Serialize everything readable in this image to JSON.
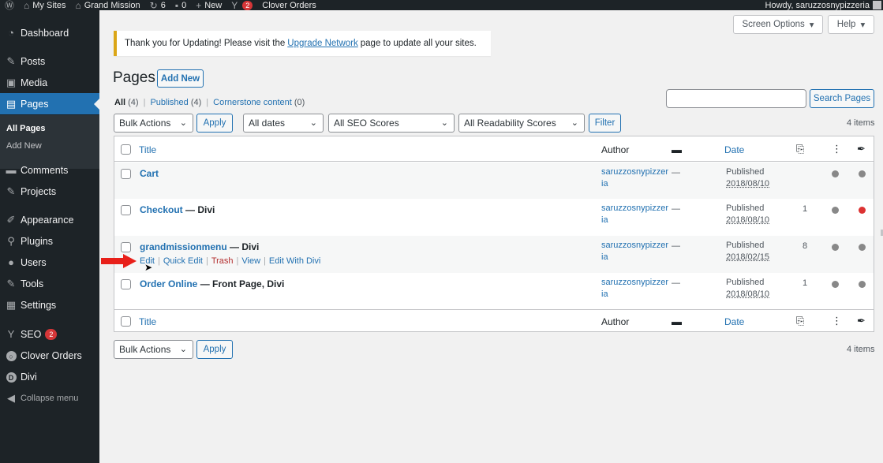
{
  "adminbar": {
    "my_sites": "My Sites",
    "site_name": "Grand Mission",
    "updates_count": "6",
    "comments_count": "0",
    "new_label": "New",
    "seo_badge": "2",
    "clover_orders": "Clover Orders",
    "howdy": "Howdy, saruzzosnypizzeria"
  },
  "sidebar": {
    "items": [
      {
        "label": "Dashboard",
        "icon": "dashboard-icon"
      },
      {
        "label": "Posts",
        "icon": "pin-icon"
      },
      {
        "label": "Media",
        "icon": "media-icon"
      },
      {
        "label": "Pages",
        "icon": "page-icon"
      },
      {
        "label": "Comments",
        "icon": "comment-icon"
      },
      {
        "label": "Projects",
        "icon": "pin-icon"
      },
      {
        "label": "Appearance",
        "icon": "brush-icon"
      },
      {
        "label": "Plugins",
        "icon": "plugin-icon"
      },
      {
        "label": "Users",
        "icon": "user-icon"
      },
      {
        "label": "Tools",
        "icon": "wrench-icon"
      },
      {
        "label": "Settings",
        "icon": "settings-icon"
      },
      {
        "label": "SEO",
        "icon": "yoast-icon",
        "badge": "2"
      },
      {
        "label": "Clover Orders",
        "icon": "clover-icon"
      },
      {
        "label": "Divi",
        "icon": "divi-icon"
      },
      {
        "label": "Collapse menu",
        "icon": "collapse-icon"
      }
    ],
    "submenu": [
      "All Pages",
      "Add New"
    ]
  },
  "top_buttons": {
    "screen_options": "Screen Options",
    "help": "Help"
  },
  "notice": {
    "before": "Thank you for Updating! Please visit the",
    "link": "Upgrade Network",
    "after": "page to update all your sites."
  },
  "page": {
    "title": "Pages",
    "add_new": "Add New"
  },
  "filters": {
    "all": "All",
    "all_count": "(4)",
    "published": "Published",
    "published_count": "(4)",
    "cornerstone": "Cornerstone content",
    "cornerstone_count": "(0)",
    "bulk_actions": "Bulk Actions",
    "apply": "Apply",
    "all_dates": "All dates",
    "all_seo": "All SEO Scores",
    "all_readability": "All Readability Scores",
    "filter": "Filter",
    "search_button": "Search Pages",
    "items_count": "4 items"
  },
  "table": {
    "headers": {
      "title": "Title",
      "author": "Author",
      "date": "Date"
    },
    "rows": [
      {
        "title": "Cart",
        "suffix": "",
        "author": "saruzzosnypizzeria",
        "comments": "—",
        "status": "Published",
        "date": "2018/08/10",
        "links": "",
        "seo_color": "#8c8f94",
        "read_color": "#8c8f94"
      },
      {
        "title": "Checkout",
        "suffix": " — Divi",
        "author": "saruzzosnypizzeria",
        "comments": "—",
        "status": "Published",
        "date": "2018/08/10",
        "links": "1",
        "seo_color": "#8c8f94",
        "read_color": "#dc3232"
      },
      {
        "title": "grandmissionmenu",
        "suffix": " — Divi",
        "author": "saruzzosnypizzeria",
        "comments": "—",
        "status": "Published",
        "date": "2018/02/15",
        "links": "8",
        "seo_color": "#8c8f94",
        "read_color": "#8c8f94"
      },
      {
        "title": "Order Online",
        "suffix": " — Front Page, Divi",
        "author": "saruzzosnypizzeria",
        "comments": "—",
        "status": "Published",
        "date": "2018/08/10",
        "links": "1",
        "seo_color": "#8c8f94",
        "read_color": "#8c8f94"
      }
    ],
    "row_actions": [
      "Edit",
      "Quick Edit",
      "Trash",
      "View",
      "Edit With Divi"
    ]
  },
  "colors": {
    "accent": "#2271b1",
    "sidebar": "#1d2327",
    "notice_border": "#dba617",
    "arrow": "#e8201a"
  }
}
